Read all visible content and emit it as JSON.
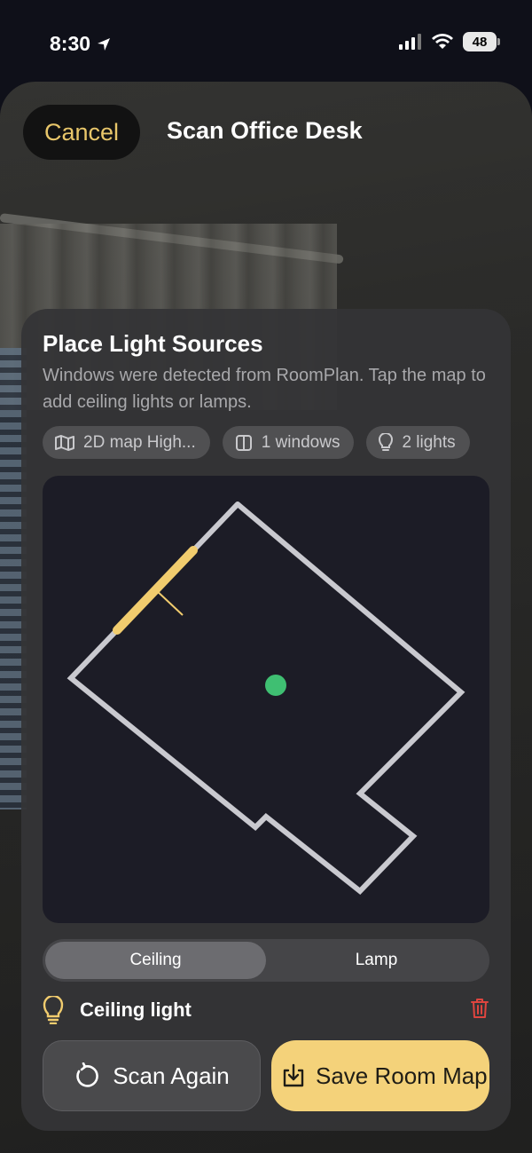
{
  "status_bar": {
    "time": "8:30",
    "battery": "48"
  },
  "header": {
    "cancel_label": "Cancel",
    "title": "Scan Office Desk"
  },
  "panel": {
    "title": "Place Light Sources",
    "description": "Windows were detected from RoomPlan. Tap the map to add ceiling lights or lamps.",
    "chips": [
      {
        "icon": "map-icon",
        "label": "2D map High..."
      },
      {
        "icon": "window-icon",
        "label": "1 windows"
      },
      {
        "icon": "lightbulb-icon",
        "label": "2 lights"
      }
    ],
    "segments": [
      {
        "label": "Ceiling",
        "active": true
      },
      {
        "label": "Lamp",
        "active": false
      }
    ],
    "selected_light": {
      "icon": "lightbulb-icon",
      "label": "Ceiling light"
    }
  },
  "actions": {
    "scan_again_label": "Scan Again",
    "save_label": "Save Room Map"
  },
  "colors": {
    "accent": "#f4d27a",
    "cancel_text": "#e8c66a",
    "wall": "#c9c9cf",
    "window": "#f1cc6e",
    "light_marker": "#3fbf72",
    "delete": "#e0453f"
  }
}
